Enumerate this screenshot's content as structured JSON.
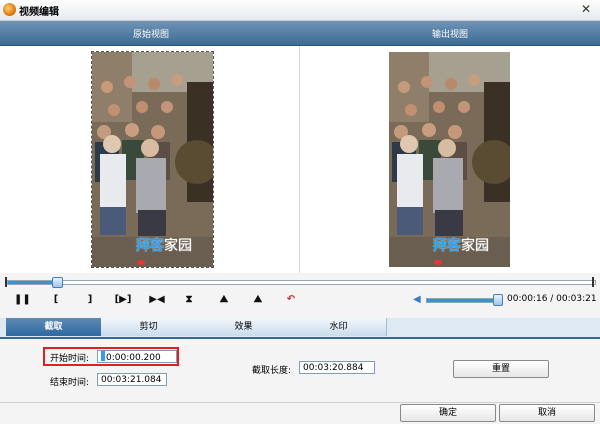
{
  "window": {
    "title": "视频编辑",
    "close_glyph": "✕"
  },
  "views": {
    "original_label": "原始视图",
    "output_label": "输出视图"
  },
  "watermark": {
    "part1": "拜客",
    "part2": "家园"
  },
  "seek": {
    "position_fraction": 0.084
  },
  "controls": {
    "pause": "❚❚",
    "mark_in": "[",
    "mark_out": "]",
    "play_segment": "[▶]",
    "frame": "▶◀",
    "trim": "⧗",
    "mountain1": "⛰",
    "mountain2": "⛰",
    "undo": "↶"
  },
  "volume": {
    "level_fraction": 1.0
  },
  "playback_time": "00:00:16 / 00:03:21",
  "tabs": [
    {
      "label": "截取",
      "active": true
    },
    {
      "label": "剪切",
      "active": false
    },
    {
      "label": "效果",
      "active": false
    },
    {
      "label": "水印",
      "active": false
    }
  ],
  "trim_panel": {
    "start_label": "开始时间:",
    "start_value": "0:00:00.200",
    "end_label": "结束时间:",
    "end_value": "00:03:21.084",
    "length_label": "截取长度:",
    "length_value": "00:03:20.884",
    "reset_label": "重置"
  },
  "footer": {
    "ok_label": "确定",
    "cancel_label": "取消"
  }
}
